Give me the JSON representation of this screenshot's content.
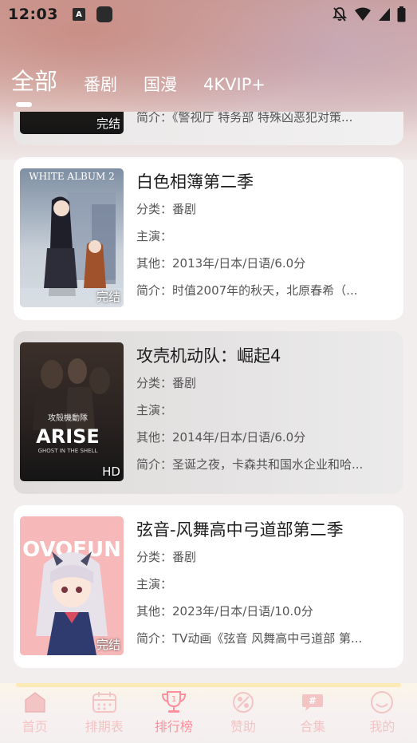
{
  "status_bar": {
    "time": "12:03",
    "app_icon_a_letter": "A"
  },
  "tabs": [
    {
      "label": "全部",
      "active": true
    },
    {
      "label": "番剧",
      "active": false
    },
    {
      "label": "国漫",
      "active": false
    },
    {
      "label": "4KVIP+",
      "active": false
    }
  ],
  "cards": [
    {
      "badge": "完结",
      "title": "",
      "category": "",
      "cast": "",
      "other": "",
      "summary": "简介：《警视厅 特务部 特殊凶恶犯对策..."
    },
    {
      "badge": "完结",
      "title": "白色相簿第二季",
      "category": "分类：番剧",
      "cast": "主演：",
      "other": "其他：2013年/日本/日语/6.0分",
      "summary": "简介：时值2007年的秋天，北原春希（..."
    },
    {
      "badge": "HD",
      "title": "攻壳机动队：崛起4",
      "category": "分类：番剧",
      "cast": "主演：",
      "other": "其他：2014年/日本/日语/6.0分",
      "summary": "简介：圣诞之夜，卡森共和国水企业和哈..."
    },
    {
      "badge": "完结",
      "title": "弦音-风舞高中弓道部第二季",
      "category": "分类：番剧",
      "cast": "主演：",
      "other": "其他：2023年/日本/日语/10.0分",
      "summary": "简介：TV动画《弦音 风舞高中弓道部 第..."
    }
  ],
  "poster_text": {
    "white_album": "WHITE ALBUM 2",
    "arise_jp": "攻殻機動隊",
    "arise": "ARISE",
    "arise_sub": "GHOST IN THE SHELL",
    "ovofun": "OVOFUN"
  },
  "bottom_nav": [
    {
      "label": "首页",
      "icon": "home-icon",
      "active": false
    },
    {
      "label": "排期表",
      "icon": "calendar-icon",
      "active": false
    },
    {
      "label": "排行榜",
      "icon": "trophy-icon",
      "active": true
    },
    {
      "label": "赞助",
      "icon": "sponsor-icon",
      "active": false
    },
    {
      "label": "合集",
      "icon": "collection-icon",
      "active": false
    },
    {
      "label": "我的",
      "icon": "profile-icon",
      "active": false
    }
  ],
  "colors": {
    "nav_active": "#ff8f9c",
    "nav_inactive": "#f3c4c4",
    "card_bg": "#ffffff"
  }
}
